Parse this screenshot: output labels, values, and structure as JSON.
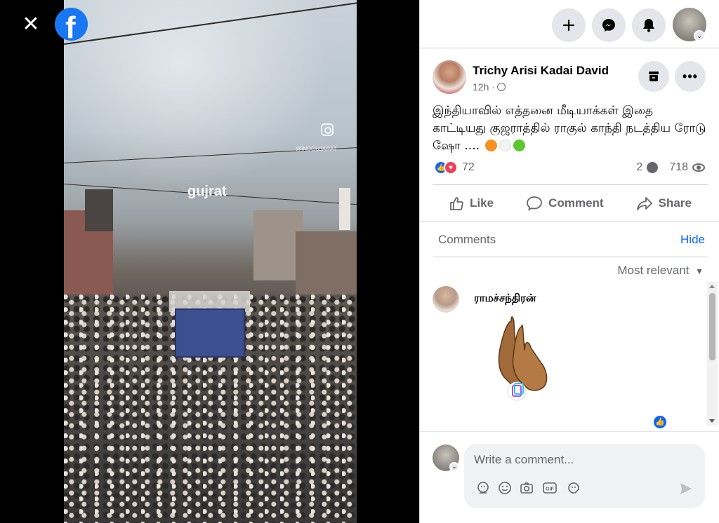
{
  "viewer": {
    "close_icon": "close-icon",
    "logo_icon": "facebook-logo",
    "logo_letter": "f",
    "video_watermark": "gujrat",
    "video_handle": "@INDGUJARAT"
  },
  "topbar": {
    "create_icon": "plus-icon",
    "messenger_icon": "messenger-icon",
    "notifications_icon": "bell-icon"
  },
  "post": {
    "author": "Trichy Arisi Kadai David",
    "time": "12h ·",
    "text": "இந்தியாவில் எத்தனை மீடியாக்கள் இதை காட்டியது குஜராத்தில் ராகுல் காந்தி நடத்திய ரோடு ஷோ ....",
    "reaction_count": "72",
    "comment_count": "2",
    "view_count": "718",
    "actions": {
      "like": "Like",
      "comment": "Comment",
      "share": "Share"
    }
  },
  "comments": {
    "label": "Comments",
    "hide": "Hide",
    "sort": "Most relevant",
    "items": [
      {
        "author": "ராமச்சந்திரன்"
      }
    ]
  },
  "composer": {
    "placeholder": "Write a comment..."
  },
  "colors": {
    "accent": "#0866ff",
    "fb_blue": "#1877f2",
    "text_secondary": "#65676b",
    "button_bg": "#e4e6eb"
  }
}
